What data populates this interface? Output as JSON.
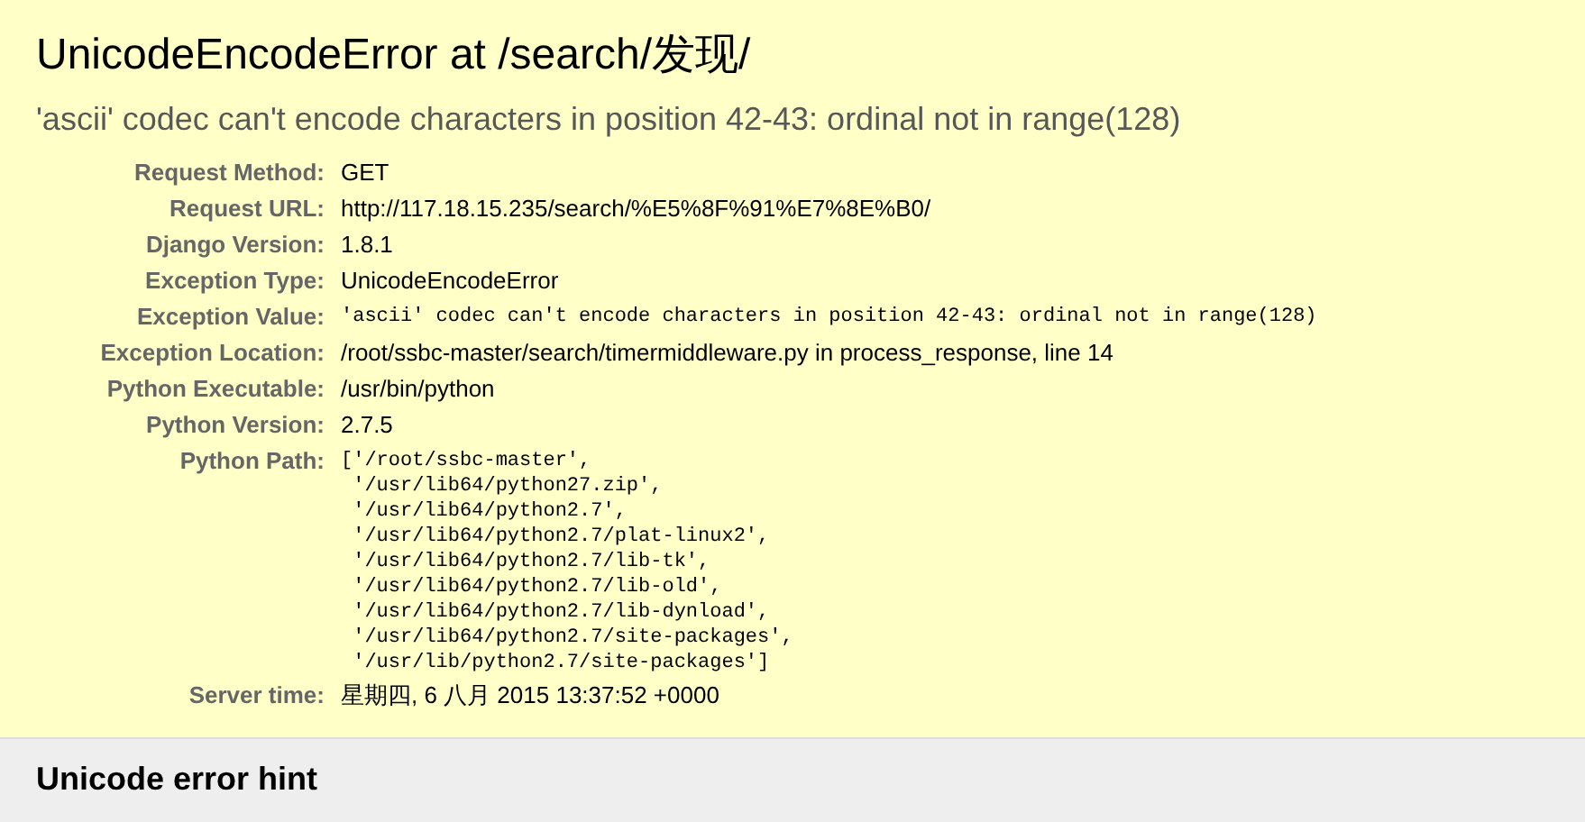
{
  "title": "UnicodeEncodeError at /search/发现/",
  "exception_value": "'ascii' codec can't encode characters in position 42-43: ordinal not in range(128)",
  "meta": [
    {
      "kind": "text",
      "label": "Request Method:",
      "value": "GET"
    },
    {
      "kind": "text",
      "label": "Request URL:",
      "value": "http://117.18.15.235/search/%E5%8F%91%E7%8E%B0/"
    },
    {
      "kind": "text",
      "label": "Django Version:",
      "value": "1.8.1"
    },
    {
      "kind": "text",
      "label": "Exception Type:",
      "value": "UnicodeEncodeError"
    },
    {
      "kind": "code",
      "label": "Exception Value:",
      "lines": [
        "'ascii' codec can't encode characters in position 42-43: ordinal not in range(128)"
      ]
    },
    {
      "kind": "text",
      "label": "Exception Location:",
      "value": "/root/ssbc-master/search/timermiddleware.py in process_response, line 14"
    },
    {
      "kind": "text",
      "label": "Python Executable:",
      "value": "/usr/bin/python"
    },
    {
      "kind": "text",
      "label": "Python Version:",
      "value": "2.7.5"
    },
    {
      "kind": "code",
      "label": "Python Path:",
      "lines": [
        "['/root/ssbc-master',",
        " '/usr/lib64/python27.zip',",
        " '/usr/lib64/python2.7',",
        " '/usr/lib64/python2.7/plat-linux2',",
        " '/usr/lib64/python2.7/lib-tk',",
        " '/usr/lib64/python2.7/lib-old',",
        " '/usr/lib64/python2.7/lib-dynload',",
        " '/usr/lib64/python2.7/site-packages',",
        " '/usr/lib/python2.7/site-packages']"
      ]
    },
    {
      "kind": "text",
      "label": "Server time:",
      "value": "星期四, 6 八月 2015 13:37:52 +0000"
    }
  ],
  "hint": {
    "title": "Unicode error hint"
  }
}
